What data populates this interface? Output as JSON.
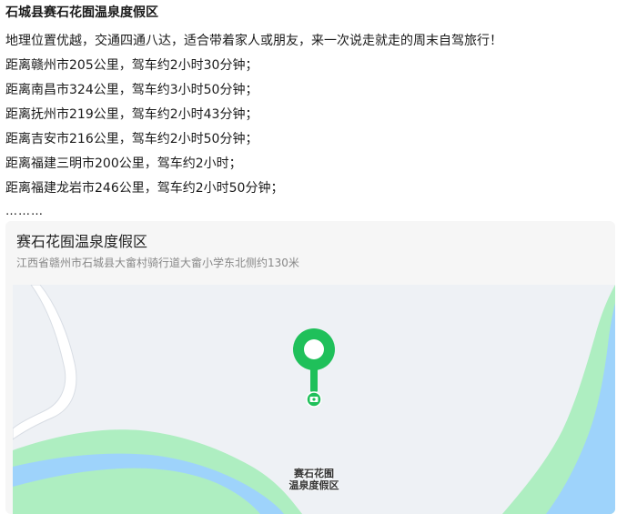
{
  "article": {
    "headline": "石城县赛石花囿温泉度假区",
    "lines": [
      "地理位置优越，交通四通八达，适合带着家人或朋友，来一次说走就走的周末自驾旅行！",
      "距离赣州市205公里，驾车约2小时30分钟；",
      "距离南昌市324公里，驾车约3小时50分钟；",
      "距离抚州市219公里，驾车约2小时43分钟；",
      "距离吉安市216公里，驾车约2小时50分钟；",
      "距离福建三明市200公里，驾车约2小时；",
      "距离福建龙岩市246公里，驾车约2小时50分钟；"
    ],
    "ellipsis": "………"
  },
  "map_card": {
    "title": "赛石花囿温泉度假区",
    "address": "江西省赣州市石城县大畲村骑行道大畲小学东北侧约130米",
    "poi_label_line1": "赛石花囿",
    "poi_label_line2": "温泉度假区",
    "marker_icon": "map-pin-icon",
    "poi_icon": "camera-icon"
  },
  "colors": {
    "accent_green": "#1fc05a",
    "river_blue": "#9ed3fb",
    "grass_green": "#aeeec1",
    "map_bg": "#eef1f5",
    "road_white": "#ffffff"
  }
}
